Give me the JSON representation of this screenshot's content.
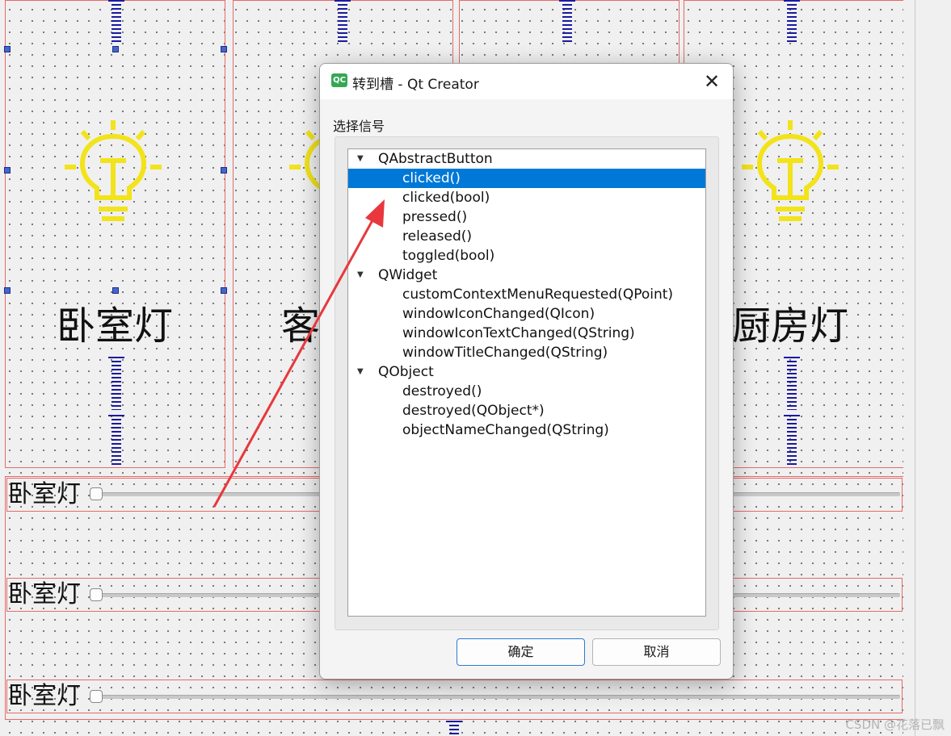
{
  "background": {
    "room_labels": {
      "bedroom": "卧室灯",
      "living_partial": "客",
      "kitchen": "厨房灯"
    },
    "slider_rows": [
      {
        "label": "卧室灯"
      },
      {
        "label": "卧室灯"
      },
      {
        "label": "卧室灯"
      }
    ],
    "colors": {
      "frame_red": "#e66a6a",
      "spring_blue": "#1a1aa0",
      "bulb_yellow": "#f2e31a",
      "arrow_red": "#e8383d"
    }
  },
  "dialog": {
    "title": "转到槽 - Qt Creator",
    "app_icon_text": "QC",
    "close_icon": "close-icon",
    "group_label": "选择信号",
    "tree": [
      {
        "label": "QAbstractButton",
        "level": 0,
        "expanded": true
      },
      {
        "label": "clicked()",
        "level": 1,
        "selected": true
      },
      {
        "label": "clicked(bool)",
        "level": 1
      },
      {
        "label": "pressed()",
        "level": 1
      },
      {
        "label": "released()",
        "level": 1
      },
      {
        "label": "toggled(bool)",
        "level": 1
      },
      {
        "label": "QWidget",
        "level": 0,
        "expanded": true
      },
      {
        "label": "customContextMenuRequested(QPoint)",
        "level": 1
      },
      {
        "label": "windowIconChanged(QIcon)",
        "level": 1
      },
      {
        "label": "windowIconTextChanged(QString)",
        "level": 1
      },
      {
        "label": "windowTitleChanged(QString)",
        "level": 1
      },
      {
        "label": "QObject",
        "level": 0,
        "expanded": true
      },
      {
        "label": "destroyed()",
        "level": 1
      },
      {
        "label": "destroyed(QObject*)",
        "level": 1
      },
      {
        "label": "objectNameChanged(QString)",
        "level": 1
      }
    ],
    "ok_label": "确定",
    "cancel_label": "取消",
    "selection_color": "#0078d7"
  },
  "watermark": "CSDN @花落已飘"
}
